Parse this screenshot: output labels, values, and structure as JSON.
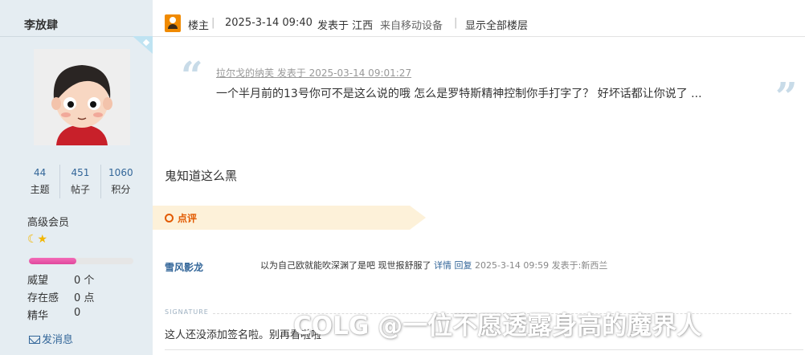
{
  "user": {
    "name": "李放肆",
    "stats": [
      {
        "value": "44",
        "label": "主题"
      },
      {
        "value": "451",
        "label": "帖子"
      },
      {
        "value": "1060",
        "label": "积分"
      }
    ],
    "group": "高级会员",
    "stars": "☾★",
    "level_progress": 0.45,
    "meta": [
      {
        "label": "威望",
        "value": "0 个"
      },
      {
        "label": "存在感",
        "value": "0 点"
      },
      {
        "label": "精华",
        "value": "0"
      }
    ],
    "send_message": "发消息"
  },
  "post": {
    "role": "楼主",
    "datetime": "2025-3-14 09:40",
    "posted_in": "发表于 江西",
    "device": "来自移动设备",
    "show_all": "显示全部楼层",
    "quote": {
      "author_line": "拉尔戈的纳芙 发表于 2025-03-14 09:01:27",
      "text": "一个半月前的13号你可不是这么说的哦 怎么是罗特斯精神控制你手打字了？ 好坏话都让你说了 ..."
    },
    "body": "鬼知道这么黑"
  },
  "rating": {
    "label": "点评",
    "comment": {
      "user": "雪风影龙",
      "text": "以为自己欧就能吹深渊了是吧 现世报舒服了",
      "detail": "详情",
      "reply": "回复",
      "time": "2025-3-14 09:59",
      "location": "发表于:新西兰"
    }
  },
  "signature": {
    "label": "SIGNATURE",
    "text": "这人还没添加签名啦。别再看啦啦"
  },
  "watermark": "COLG @一位不愿透露身高的魔界人",
  "colors": {
    "sidebar_bg": "#e5edf2",
    "link": "#336699",
    "accent_orange": "#e25a00",
    "progress": "#e0489c"
  }
}
